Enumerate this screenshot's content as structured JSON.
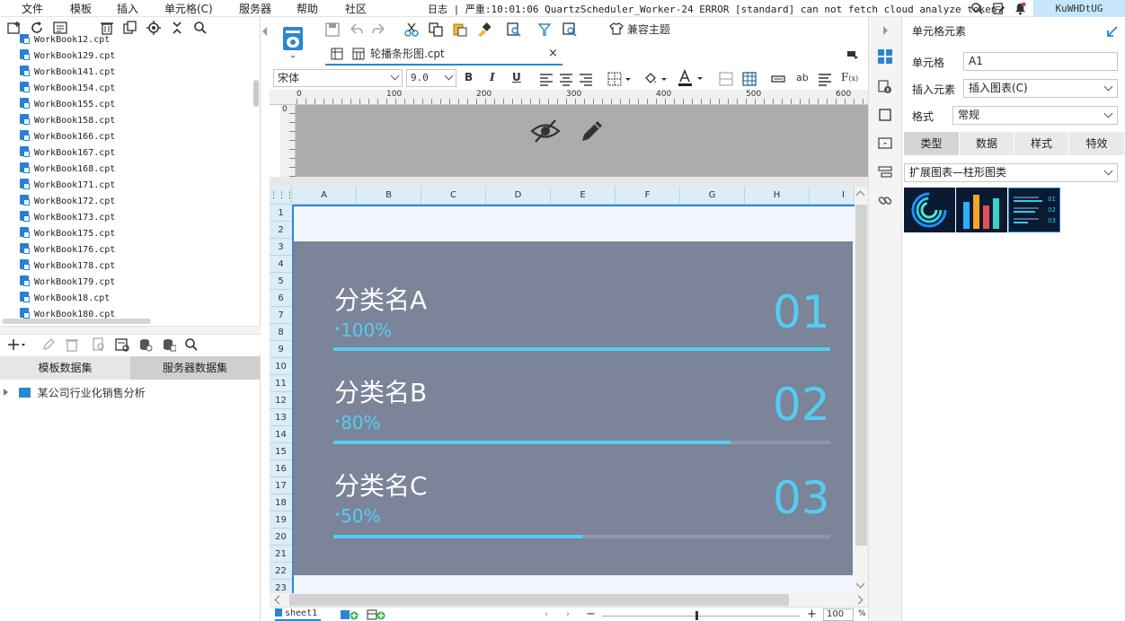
{
  "menubar": {
    "items": [
      "文件",
      "模板",
      "插入",
      "单元格(C)",
      "服务器",
      "帮助",
      "社区"
    ],
    "log": "日志 | 严重:10:01:06 QuartzScheduler_Worker-24 ERROR [standard] can not fetch cloud analyze token.",
    "user": "KuWHDtUG"
  },
  "left": {
    "files": [
      "WorkBook12.cpt",
      "WorkBook129.cpt",
      "WorkBook141.cpt",
      "WorkBook154.cpt",
      "WorkBook155.cpt",
      "WorkBook158.cpt",
      "WorkBook166.cpt",
      "WorkBook167.cpt",
      "WorkBook168.cpt",
      "WorkBook171.cpt",
      "WorkBook172.cpt",
      "WorkBook173.cpt",
      "WorkBook175.cpt",
      "WorkBook176.cpt",
      "WorkBook178.cpt",
      "WorkBook179.cpt",
      "WorkBook18.cpt",
      "WorkBook180.cpt"
    ],
    "tabs": [
      "模板数据集",
      "服务器数据集"
    ],
    "dataset": "某公司行业化销售分析"
  },
  "center": {
    "compat_theme": "兼容主题",
    "file_tab": "轮播条形图.cpt",
    "font_name": "宋体",
    "font_size": "9.0",
    "ruler": [
      "0",
      "100",
      "200",
      "300",
      "400",
      "500",
      "600"
    ],
    "ruler_v": "0",
    "columns": [
      "A",
      "B",
      "C",
      "D",
      "E",
      "F",
      "G",
      "H",
      "I"
    ],
    "rows": [
      "1",
      "2",
      "3",
      "4",
      "5",
      "6",
      "7",
      "8",
      "9",
      "10",
      "11",
      "12",
      "13",
      "14",
      "15",
      "16",
      "17",
      "18",
      "19",
      "20",
      "21",
      "22",
      "23"
    ],
    "sheet": "sheet1",
    "zoom": "100",
    "zoom_unit": "%",
    "bars": [
      {
        "name": "分类名A",
        "percent": "100%",
        "index": "01",
        "value": 1.0
      },
      {
        "name": "分类名B",
        "percent": "80%",
        "index": "02",
        "value": 0.8
      },
      {
        "name": "分类名C",
        "percent": "50%",
        "index": "03",
        "value": 0.5
      }
    ]
  },
  "right": {
    "title": "单元格元素",
    "cell_label": "单元格",
    "cell_value": "A1",
    "insert_label": "插入元素",
    "insert_value": "插入图表(C)",
    "format_label": "格式",
    "format_value": "常规",
    "tabs": [
      "类型",
      "数据",
      "样式",
      "特效"
    ],
    "chart_type": "扩展图表—柱形图类"
  },
  "colors": {
    "accent": "#2b86d1",
    "chart_bg": "#7b8499",
    "bar": "#55ccf2"
  }
}
